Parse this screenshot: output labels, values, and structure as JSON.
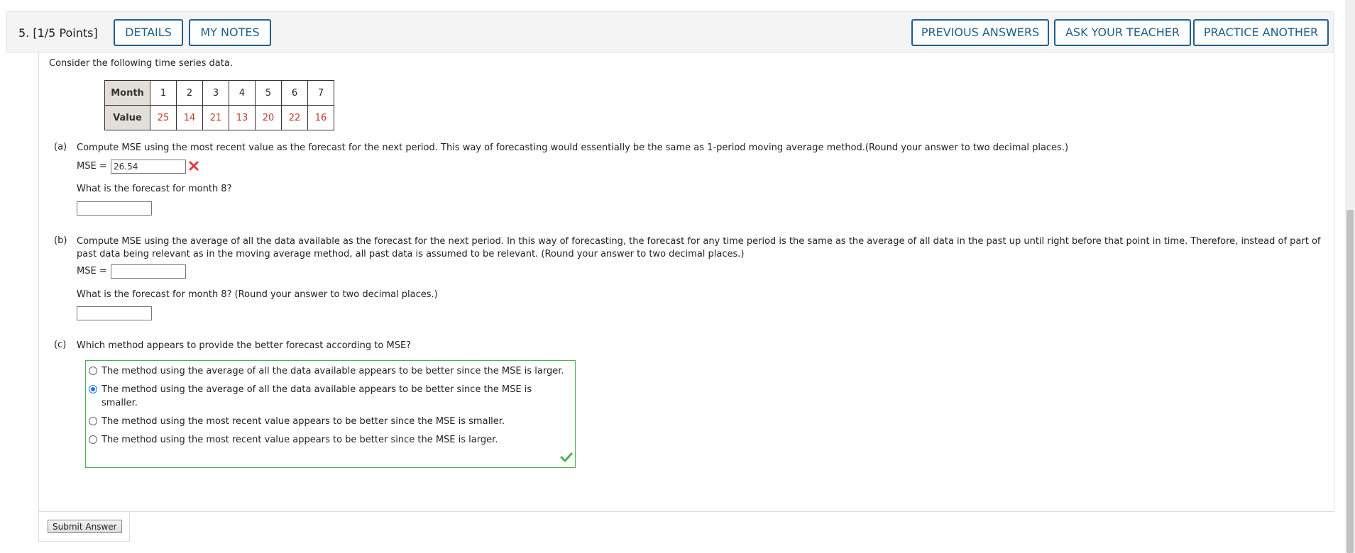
{
  "header": {
    "question_number": "5.",
    "points": "[1/5 Points]",
    "buttons": {
      "details": "DETAILS",
      "my_notes": "MY NOTES",
      "previous_answers": "PREVIOUS ANSWERS",
      "ask_teacher": "ASK YOUR TEACHER",
      "practice_another": "PRACTICE ANOTHER"
    }
  },
  "intro": "Consider the following time series data.",
  "table": {
    "row1_header": "Month",
    "months": [
      "1",
      "2",
      "3",
      "4",
      "5",
      "6",
      "7"
    ],
    "row2_header": "Value",
    "values": [
      "25",
      "14",
      "21",
      "13",
      "20",
      "22",
      "16"
    ]
  },
  "part_a": {
    "label": "(a)",
    "text": "Compute MSE using the most recent value as the forecast for the next period. This way of forecasting would essentially be the same as 1-period moving average method.(Round your answer to two decimal places.)",
    "mse_label": "MSE =",
    "mse_value": "26.54",
    "mse_status": "incorrect",
    "forecast_question": "What is the forecast for month 8?",
    "forecast_value": ""
  },
  "part_b": {
    "label": "(b)",
    "text": "Compute MSE using the average of all the data available as the forecast for the next period. In this way of forecasting, the forecast for any time period is the same as the average of all data in the past up until right before that point in time. Therefore, instead of part of past data being relevant as in the moving average method, all past data is assumed to be relevant. (Round your answer to two decimal places.)",
    "mse_label": "MSE =",
    "mse_value": "",
    "forecast_question": "What is the forecast for month 8? (Round your answer to two decimal places.)",
    "forecast_value": ""
  },
  "part_c": {
    "label": "(c)",
    "text": "Which method appears to provide the better forecast according to MSE?",
    "options": [
      "The method using the average of all the data available appears to be better since the MSE is larger.",
      "The method using the average of all the data available appears to be better since the MSE is smaller.",
      "The method using the most recent value appears to be better since the MSE is smaller.",
      "The method using the most recent value appears to be better since the MSE is larger."
    ],
    "selected_index": 1,
    "status": "correct"
  },
  "submit_label": "Submit Answer",
  "colors": {
    "button_border": "#1f5f8b",
    "table_value_red": "#c0392b",
    "correct_green": "#4caf50",
    "incorrect_red": "#e53935",
    "radio_selected": "#1a73e8"
  },
  "icons": {
    "incorrect": "x-mark-icon",
    "correct": "checkmark-icon"
  }
}
